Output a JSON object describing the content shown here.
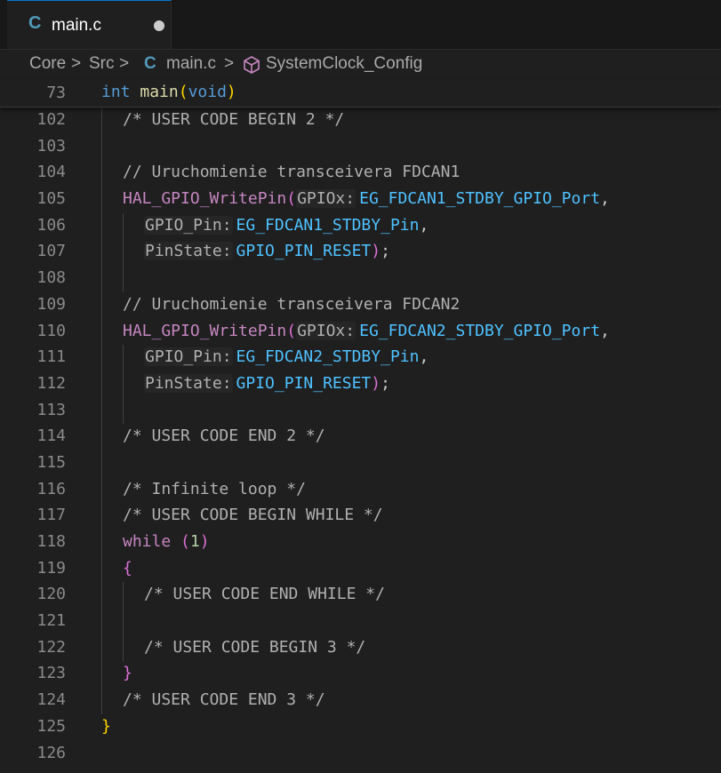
{
  "tab": {
    "icon": "C",
    "label": "main.c"
  },
  "breadcrumb": {
    "core": "Core",
    "src": "Src",
    "file_icon": "C",
    "file": "main.c",
    "symbol": "SystemClock_Config",
    "sep": ">"
  },
  "sticky": {
    "line_no": "73",
    "t1": "int",
    "t2": "main",
    "t3": "(",
    "t4": "void",
    "t5": ")"
  },
  "lines": {
    "l102": {
      "no": "102",
      "text": "/* USER CODE BEGIN 2 */"
    },
    "l103": {
      "no": "103"
    },
    "l104": {
      "no": "104",
      "text": "// Uruchomienie transceivera FDCAN1"
    },
    "l105": {
      "no": "105",
      "fn": "HAL_GPIO_WritePin",
      "open": "(",
      "hint": "GPIOx:",
      "arg": "EG_FDCAN1_STDBY_GPIO_Port",
      "comma": ","
    },
    "l106": {
      "no": "106",
      "hint": "GPIO_Pin:",
      "arg": "EG_FDCAN1_STDBY_Pin",
      "comma": ","
    },
    "l107": {
      "no": "107",
      "hint": "PinState:",
      "arg": "GPIO_PIN_RESET",
      "close": ")",
      "semi": ";"
    },
    "l108": {
      "no": "108"
    },
    "l109": {
      "no": "109",
      "text": "// Uruchomienie transceivera FDCAN2"
    },
    "l110": {
      "no": "110",
      "fn": "HAL_GPIO_WritePin",
      "open": "(",
      "hint": "GPIOx:",
      "arg": "EG_FDCAN2_STDBY_GPIO_Port",
      "comma": ","
    },
    "l111": {
      "no": "111",
      "hint": "GPIO_Pin:",
      "arg": "EG_FDCAN2_STDBY_Pin",
      "comma": ","
    },
    "l112": {
      "no": "112",
      "hint": "PinState:",
      "arg": "GPIO_PIN_RESET",
      "close": ")",
      "semi": ";"
    },
    "l113": {
      "no": "113"
    },
    "l114": {
      "no": "114",
      "text": "/* USER CODE END 2 */"
    },
    "l115": {
      "no": "115"
    },
    "l116": {
      "no": "116",
      "text": "/* Infinite loop */"
    },
    "l117": {
      "no": "117",
      "text": "/* USER CODE BEGIN WHILE */"
    },
    "l118": {
      "no": "118",
      "kw": "while",
      "open": "(",
      "num": "1",
      "close": ")"
    },
    "l119": {
      "no": "119",
      "text": "{"
    },
    "l120": {
      "no": "120",
      "text": "/* USER CODE END WHILE */"
    },
    "l121": {
      "no": "121"
    },
    "l122": {
      "no": "122",
      "text": "/* USER CODE BEGIN 3 */"
    },
    "l123": {
      "no": "123",
      "text": "}"
    },
    "l124": {
      "no": "124",
      "text": "/* USER CODE END 3 */"
    },
    "l125": {
      "no": "125",
      "text": "}"
    },
    "l126": {
      "no": "126"
    }
  },
  "colors": {
    "background": "#1f1f1f",
    "keyword": "#c586c0",
    "type": "#569cd6",
    "function": "#dcdcaa",
    "constant": "#4fc1ff",
    "comment": "#b0b0b0"
  }
}
